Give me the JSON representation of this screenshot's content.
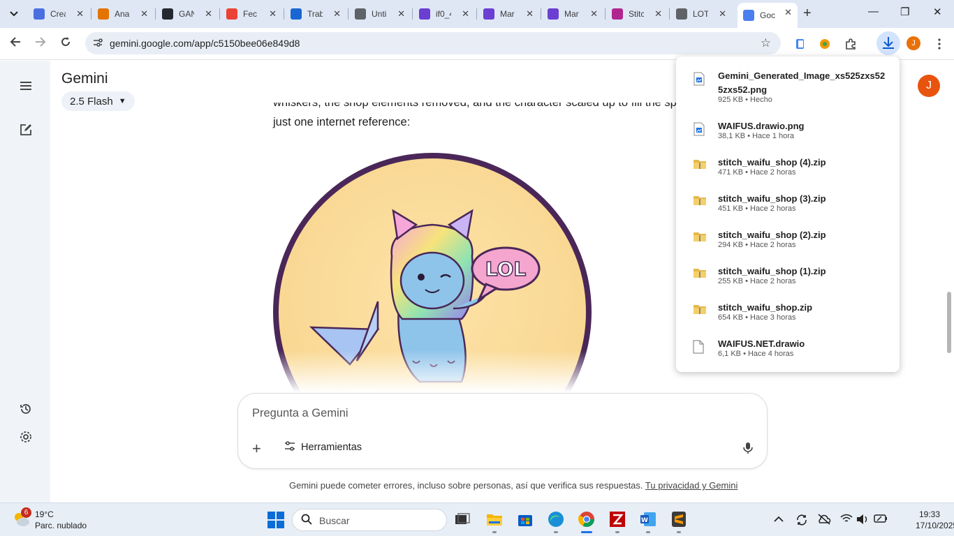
{
  "browser": {
    "tabs": [
      {
        "title": "Crea",
        "icon": "canva-icon",
        "color": "#4b6fe0"
      },
      {
        "title": "Ana",
        "icon": "analytics-icon",
        "color": "#e37400"
      },
      {
        "title": "GAN",
        "icon": "github-icon",
        "color": "#24292f"
      },
      {
        "title": "Fec",
        "icon": "gmail-icon",
        "color": "#ea4335"
      },
      {
        "title": "Trab",
        "icon": "classroom-icon",
        "color": "#1967d2"
      },
      {
        "title": "Unti",
        "icon": "flow-icon",
        "color": "#5f6368"
      },
      {
        "title": "if0_4",
        "icon": "infinity-icon",
        "color": "#6b3fd1"
      },
      {
        "title": "Mar",
        "icon": "infinity-icon",
        "color": "#6b3fd1"
      },
      {
        "title": "Mar",
        "icon": "infinity-icon",
        "color": "#6b3fd1"
      },
      {
        "title": "Stitc",
        "icon": "flask-icon",
        "color": "#b0268f"
      },
      {
        "title": "LOT",
        "icon": "globe-icon",
        "color": "#5f6368"
      },
      {
        "title": "Goc",
        "icon": "gemini-icon",
        "color": "#4a7ff0",
        "active": true
      }
    ],
    "url": "gemini.google.com/app/c5150bee06e849d8",
    "profile_initial": "J"
  },
  "gemini": {
    "title": "Gemini",
    "model": "2.5 Flash",
    "avatar_initial": "J",
    "response_line1_partial": "whiskers, the shop elements removed, and the character scaled up to fill the sp",
    "response_line2": "just one internet reference:",
    "image_bubble_text": "LOL",
    "prompt_placeholder": "Pregunta a Gemini",
    "tools_label": "Herramientas",
    "disclaimer": "Gemini puede cometer errores, incluso sobre personas, así que verifica sus respuestas.",
    "privacy_link": "Tu privacidad y Gemini"
  },
  "downloads": [
    {
      "name": "Gemini_Generated_Image_xs525zxs525zxs52.png",
      "meta": "925 KB • Hecho",
      "type": "image"
    },
    {
      "name": "WAIFUS.drawio.png",
      "meta": "38,1 KB • Hace 1 hora",
      "type": "image"
    },
    {
      "name": "stitch_waifu_shop (4).zip",
      "meta": "471 KB • Hace 2 horas",
      "type": "zip"
    },
    {
      "name": "stitch_waifu_shop (3).zip",
      "meta": "451 KB • Hace 2 horas",
      "type": "zip"
    },
    {
      "name": "stitch_waifu_shop (2).zip",
      "meta": "294 KB • Hace 2 horas",
      "type": "zip"
    },
    {
      "name": "stitch_waifu_shop (1).zip",
      "meta": "255 KB • Hace 2 horas",
      "type": "zip"
    },
    {
      "name": "stitch_waifu_shop.zip",
      "meta": "654 KB • Hace 3 horas",
      "type": "zip"
    },
    {
      "name": "WAIFUS.NET.drawio",
      "meta": "6,1 KB • Hace 4 horas",
      "type": "file"
    }
  ],
  "taskbar": {
    "weather_badge": "6",
    "temperature": "19°C",
    "condition": "Parc. nublado",
    "search_label": "Buscar",
    "time": "19:33",
    "date": "17/10/2025"
  }
}
